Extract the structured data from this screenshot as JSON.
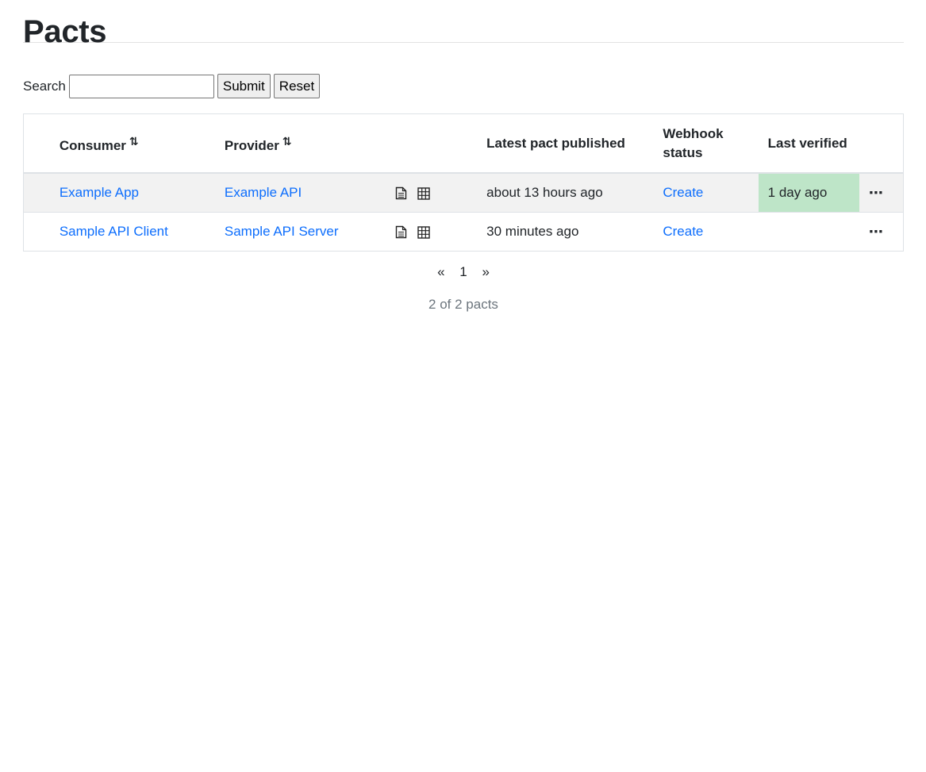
{
  "page": {
    "title": "Pacts"
  },
  "search": {
    "label": "Search",
    "value": "",
    "submit_label": "Submit",
    "reset_label": "Reset"
  },
  "table": {
    "headers": {
      "consumer": "Consumer",
      "provider": "Provider",
      "latest_published": "Latest pact published",
      "webhook_status": "Webhook status",
      "last_verified": "Last verified"
    },
    "sort_icon": "sort-arrows-icon",
    "rows": [
      {
        "consumer": "Example App",
        "provider": "Example API",
        "latest_published": "about 13 hours ago",
        "webhook_status": "Create",
        "last_verified": "1 day ago",
        "verified_color": "#bee5c8"
      },
      {
        "consumer": "Sample API Client",
        "provider": "Sample API Server",
        "latest_published": "30 minutes ago",
        "webhook_status": "Create",
        "last_verified": ""
      }
    ]
  },
  "pagination": {
    "prev": "«",
    "current": "1",
    "next": "»"
  },
  "summary": "2 of 2 pacts",
  "colors": {
    "link": "#0d6efd",
    "row_stripe": "#f2f2f2",
    "success": "#bee5c8"
  }
}
